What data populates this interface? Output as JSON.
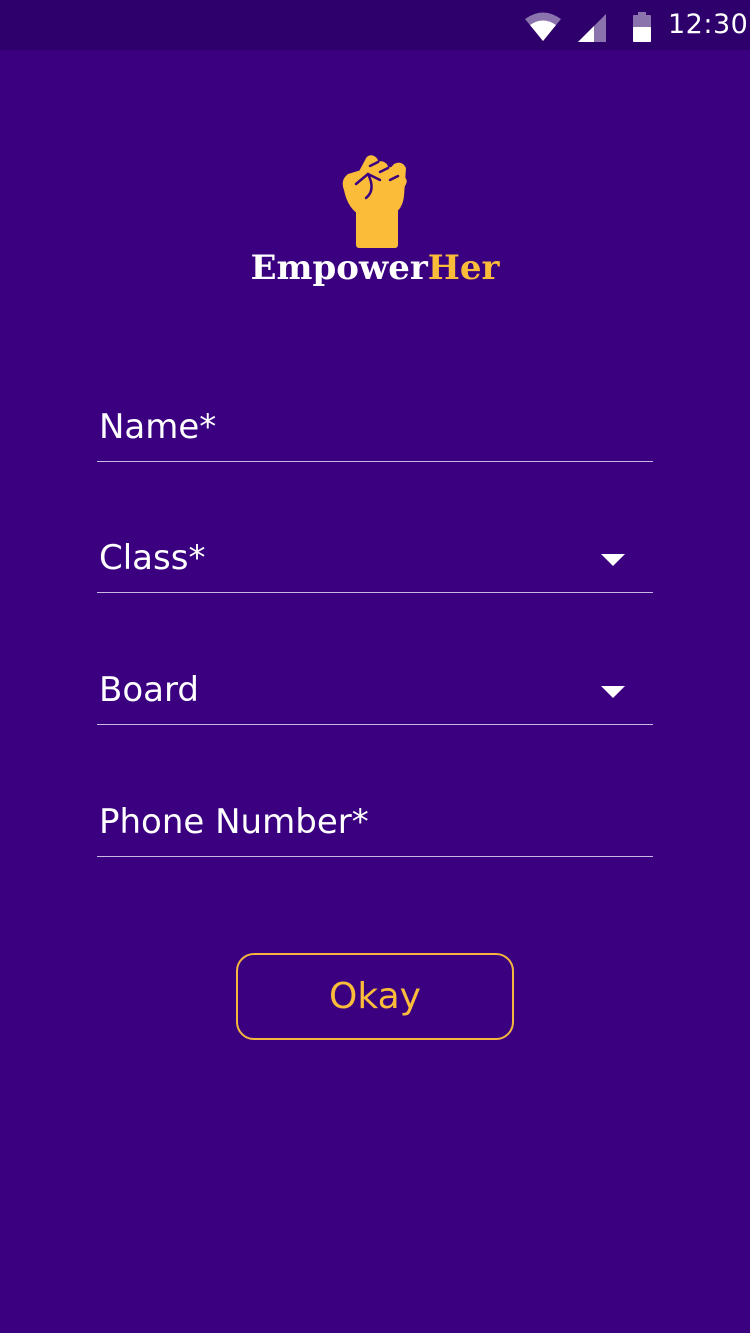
{
  "status_bar": {
    "time": "12:30",
    "icons": [
      "wifi-icon",
      "cellular-signal-icon",
      "battery-icon"
    ]
  },
  "logo": {
    "icon": "raised-fist-icon",
    "brand_part1": "Empower",
    "brand_part2": "Her"
  },
  "form": {
    "name_label": "Name*",
    "class_label": "Class*",
    "board_label": "Board",
    "phone_label": "Phone Number*",
    "submit_label": "Okay"
  },
  "colors": {
    "background": "#3a0080",
    "status_bar": "#2d006b",
    "accent": "#fbbc3a",
    "text": "#ffffff",
    "underline": "#c9b8e6"
  }
}
